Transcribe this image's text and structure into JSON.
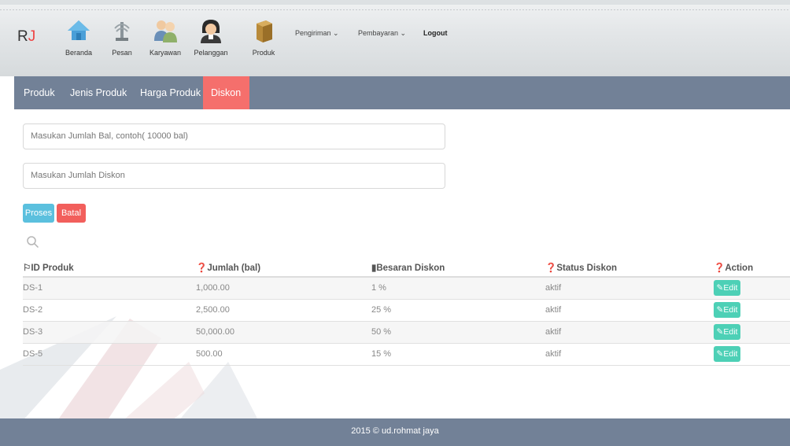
{
  "brand": {
    "logo_r": "R",
    "logo_j": "J"
  },
  "nav_icons": [
    {
      "label": "Beranda",
      "icon": "home-icon"
    },
    {
      "label": "Pesan",
      "icon": "fountain-icon"
    },
    {
      "label": "Karyawan",
      "icon": "employees-icon"
    },
    {
      "label": "Pelanggan",
      "icon": "customer-icon"
    },
    {
      "label": "Produk",
      "icon": "box-icon"
    }
  ],
  "menu": {
    "pengiriman": "Pengiriman ⌄",
    "pembayaran": "Pembayaran ⌄",
    "logout": "Logout"
  },
  "subnav": {
    "tabs": [
      "Produk",
      "Jenis Produk",
      "Harga Produk",
      "Diskon"
    ],
    "active": "Diskon"
  },
  "form": {
    "jumlah_bal_placeholder": "Masukan Jumlah Bal, contoh( 10000 bal)",
    "jumlah_diskon_placeholder": "Masukan Jumlah Diskon",
    "proses_label": "Proses",
    "batal_label": "Batal"
  },
  "table": {
    "headers": [
      "ID Produk",
      "Jumlah (bal)",
      "Besaran Diskon",
      "Status Diskon",
      "Action"
    ],
    "header_icons": [
      "flag-icon",
      "question-circle-icon",
      "bookmark-icon",
      "question-circle-icon",
      "question-circle-icon"
    ],
    "rows": [
      {
        "id": "DS-1",
        "jumlah": "1,000.00",
        "diskon": "1 %",
        "status": "aktif",
        "action": "Edit"
      },
      {
        "id": "DS-2",
        "jumlah": "2,500.00",
        "diskon": "25 %",
        "status": "aktif",
        "action": "Edit"
      },
      {
        "id": "DS-3",
        "jumlah": "50,000.00",
        "diskon": "50 %",
        "status": "aktif",
        "action": "Edit"
      },
      {
        "id": "DS-5",
        "jumlah": "500.00",
        "diskon": "15 %",
        "status": "aktif",
        "action": "Edit"
      }
    ]
  },
  "footer": {
    "text": "2015 © ud.rohmat jaya"
  },
  "colors": {
    "subnav_bg": "#728197",
    "active_tab": "#f56f6c",
    "proses_btn": "#5bc0de",
    "batal_btn": "#f25f5c",
    "edit_btn": "#4dd0b6"
  }
}
